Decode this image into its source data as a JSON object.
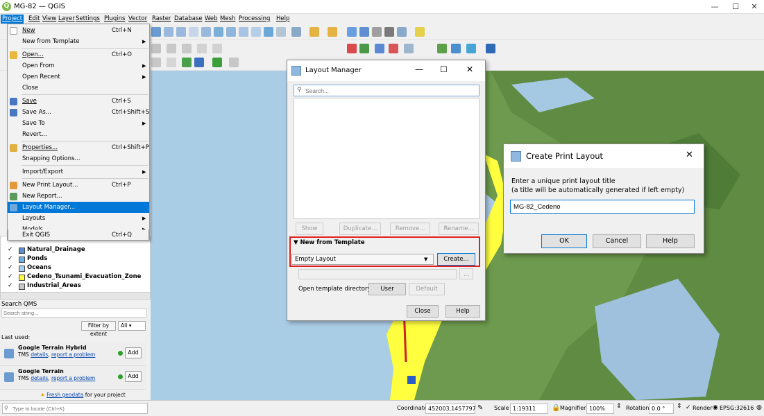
{
  "window": {
    "title": "MG-82 — QGIS",
    "minimize": "—",
    "maximize": "☐",
    "close": "✕"
  },
  "menubar": [
    "Project",
    "Edit",
    "View",
    "Layer",
    "Settings",
    "Plugins",
    "Vector",
    "Raster",
    "Database",
    "Web",
    "Mesh",
    "Processing",
    "Help"
  ],
  "project_menu": {
    "items": [
      {
        "label": "New",
        "shortcut": "Ctrl+N"
      },
      {
        "label": "New from Template",
        "shortcut": ""
      },
      {
        "label": "Open...",
        "shortcut": "Ctrl+O"
      },
      {
        "label": "Open From",
        "shortcut": ""
      },
      {
        "label": "Open Recent",
        "shortcut": ""
      },
      {
        "label": "Close",
        "shortcut": ""
      },
      {
        "label": "Save",
        "shortcut": "Ctrl+S"
      },
      {
        "label": "Save As...",
        "shortcut": "Ctrl+Shift+S"
      },
      {
        "label": "Save To",
        "shortcut": ""
      },
      {
        "label": "Revert...",
        "shortcut": ""
      },
      {
        "label": "Properties...",
        "shortcut": "Ctrl+Shift+P"
      },
      {
        "label": "Snapping Options...",
        "shortcut": ""
      },
      {
        "label": "Import/Export",
        "shortcut": ""
      },
      {
        "label": "New Print Layout...",
        "shortcut": "Ctrl+P"
      },
      {
        "label": "New Report...",
        "shortcut": ""
      },
      {
        "label": "Layout Manager...",
        "shortcut": ""
      },
      {
        "label": "Layouts",
        "shortcut": ""
      },
      {
        "label": "Models",
        "shortcut": ""
      },
      {
        "label": "Exit QGIS",
        "shortcut": "Ctrl+Q"
      }
    ]
  },
  "layers": [
    {
      "name": "Natural_Drainage",
      "color": "#5b8fd4"
    },
    {
      "name": "Ponds",
      "color": "#6fb0e0"
    },
    {
      "name": "Oceans",
      "color": "#a8d0f0"
    },
    {
      "name": "Cedeno_Tsunami_Evacuation_Zone",
      "color": "#ffff40"
    },
    {
      "name": "Industrial_Areas",
      "color": "#c8c8c8"
    }
  ],
  "qms": {
    "title": "Search QMS",
    "search_placeholder": "Search string...",
    "filter_label": "Filter by extent",
    "filter_value": "All",
    "last_used": "Last used:",
    "services": [
      {
        "name": "Google Terrain Hybrid",
        "type": "TMS",
        "details": "details",
        "report": "report a problem",
        "add": "Add"
      },
      {
        "name": "Google Terrain",
        "type": "TMS",
        "details": "details",
        "report": "report a problem",
        "add": "Add"
      }
    ],
    "geodata_link": "Fresh geodata",
    "geodata_suffix": " for your project"
  },
  "layout_manager": {
    "title": "Layout Manager",
    "search_placeholder": "Search...",
    "buttons": {
      "show": "Show",
      "duplicate": "Duplicate...",
      "remove": "Remove...",
      "rename": "Rename..."
    },
    "template_header": "New from Template",
    "template_value": "Empty Layout",
    "create": "Create...",
    "browse": "...",
    "open_dir_label": "Open template directory",
    "user": "User",
    "default": "Default",
    "close": "Close",
    "help": "Help"
  },
  "create_dialog": {
    "title": "Create Print Layout",
    "prompt1": "Enter a unique print layout title",
    "prompt2": "(a title will be automatically generated if left empty)",
    "value": "MG-82_Cedeno",
    "ok": "OK",
    "cancel": "Cancel",
    "help": "Help"
  },
  "status": {
    "locate_placeholder": "Type to locate (Ctrl+K)",
    "coordinate_label": "Coordinate",
    "coordinate": "452003,1457797",
    "scale_label": "Scale",
    "scale": "1:19311",
    "magnifier_label": "Magnifier",
    "magnifier": "100%",
    "rotation_label": "Rotation",
    "rotation": "0.0 °",
    "render_label": "Render",
    "crs": "EPSG:32616"
  }
}
